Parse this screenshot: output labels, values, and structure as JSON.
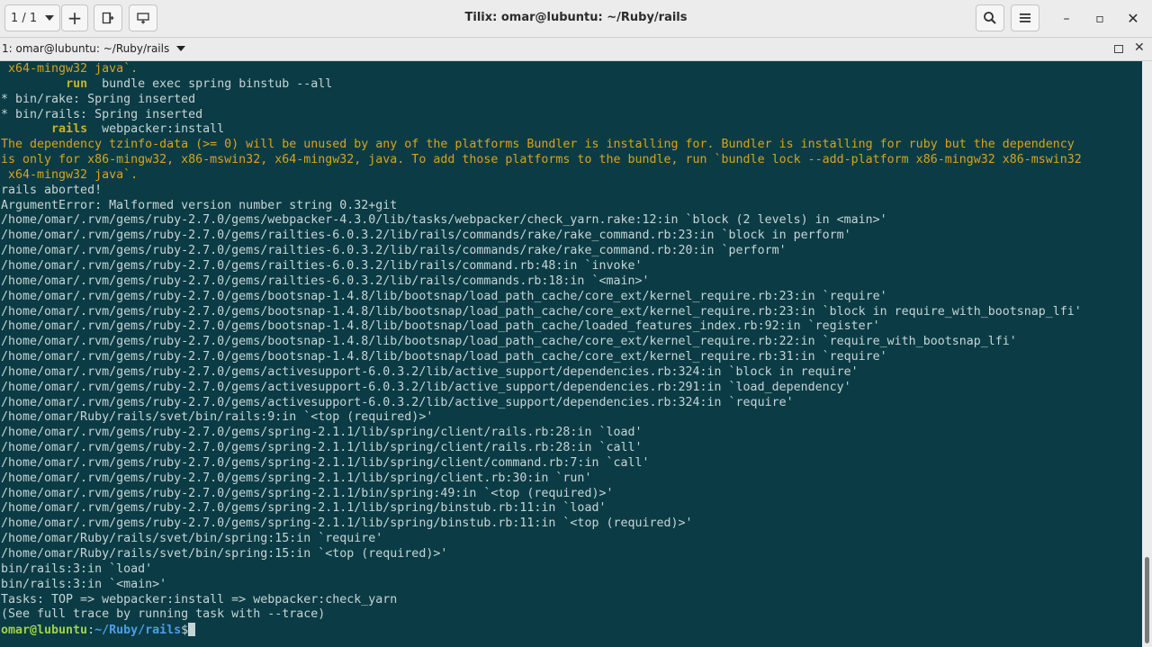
{
  "window": {
    "title": "Tilix: omar@lubuntu: ~/Ruby/rails"
  },
  "header": {
    "session_counter": "1 / 1",
    "add_label": "+",
    "buttons": [
      "add-terminal-right-icon",
      "add-terminal-down-icon"
    ],
    "search_icon": "search-icon",
    "menu_icon": "hamburger-menu-icon",
    "window_controls": {
      "minimize": "–",
      "maximize": "▫",
      "close": "✕"
    }
  },
  "terminal_tab": {
    "title": "1: omar@lubuntu: ~/Ruby/rails",
    "close_label": "✕"
  },
  "terminal": {
    "lines": [
      {
        "type": "warn",
        "text": " x64-mingw32 java`."
      },
      {
        "type": "cmd",
        "indent": "         ",
        "keyword": "run",
        "rest": "  bundle exec spring binstub --all"
      },
      {
        "type": "plain",
        "text": "* bin/rake: Spring inserted"
      },
      {
        "type": "plain",
        "text": "* bin/rails: Spring inserted"
      },
      {
        "type": "cmd",
        "indent": "       ",
        "keyword": "rails",
        "rest": "  webpacker:install"
      },
      {
        "type": "warn",
        "text": "The dependency tzinfo-data (>= 0) will be unused by any of the platforms Bundler is installing for. Bundler is installing for ruby but the dependency"
      },
      {
        "type": "warn",
        "text": "is only for x86-mingw32, x86-mswin32, x64-mingw32, java. To add those platforms to the bundle, run `bundle lock --add-platform x86-mingw32 x86-mswin32"
      },
      {
        "type": "warn",
        "text": " x64-mingw32 java`."
      },
      {
        "type": "plain",
        "text": "rails aborted!"
      },
      {
        "type": "plain",
        "text": "ArgumentError: Malformed version number string 0.32+git"
      },
      {
        "type": "plain",
        "text": "/home/omar/.rvm/gems/ruby-2.7.0/gems/webpacker-4.3.0/lib/tasks/webpacker/check_yarn.rake:12:in `block (2 levels) in <main>'"
      },
      {
        "type": "plain",
        "text": "/home/omar/.rvm/gems/ruby-2.7.0/gems/railties-6.0.3.2/lib/rails/commands/rake/rake_command.rb:23:in `block in perform'"
      },
      {
        "type": "plain",
        "text": "/home/omar/.rvm/gems/ruby-2.7.0/gems/railties-6.0.3.2/lib/rails/commands/rake/rake_command.rb:20:in `perform'"
      },
      {
        "type": "plain",
        "text": "/home/omar/.rvm/gems/ruby-2.7.0/gems/railties-6.0.3.2/lib/rails/command.rb:48:in `invoke'"
      },
      {
        "type": "plain",
        "text": "/home/omar/.rvm/gems/ruby-2.7.0/gems/railties-6.0.3.2/lib/rails/commands.rb:18:in `<main>'"
      },
      {
        "type": "plain",
        "text": "/home/omar/.rvm/gems/ruby-2.7.0/gems/bootsnap-1.4.8/lib/bootsnap/load_path_cache/core_ext/kernel_require.rb:23:in `require'"
      },
      {
        "type": "plain",
        "text": "/home/omar/.rvm/gems/ruby-2.7.0/gems/bootsnap-1.4.8/lib/bootsnap/load_path_cache/core_ext/kernel_require.rb:23:in `block in require_with_bootsnap_lfi'"
      },
      {
        "type": "plain",
        "text": "/home/omar/.rvm/gems/ruby-2.7.0/gems/bootsnap-1.4.8/lib/bootsnap/load_path_cache/loaded_features_index.rb:92:in `register'"
      },
      {
        "type": "plain",
        "text": "/home/omar/.rvm/gems/ruby-2.7.0/gems/bootsnap-1.4.8/lib/bootsnap/load_path_cache/core_ext/kernel_require.rb:22:in `require_with_bootsnap_lfi'"
      },
      {
        "type": "plain",
        "text": "/home/omar/.rvm/gems/ruby-2.7.0/gems/bootsnap-1.4.8/lib/bootsnap/load_path_cache/core_ext/kernel_require.rb:31:in `require'"
      },
      {
        "type": "plain",
        "text": "/home/omar/.rvm/gems/ruby-2.7.0/gems/activesupport-6.0.3.2/lib/active_support/dependencies.rb:324:in `block in require'"
      },
      {
        "type": "plain",
        "text": "/home/omar/.rvm/gems/ruby-2.7.0/gems/activesupport-6.0.3.2/lib/active_support/dependencies.rb:291:in `load_dependency'"
      },
      {
        "type": "plain",
        "text": "/home/omar/.rvm/gems/ruby-2.7.0/gems/activesupport-6.0.3.2/lib/active_support/dependencies.rb:324:in `require'"
      },
      {
        "type": "plain",
        "text": "/home/omar/Ruby/rails/svet/bin/rails:9:in `<top (required)>'"
      },
      {
        "type": "plain",
        "text": "/home/omar/.rvm/gems/ruby-2.7.0/gems/spring-2.1.1/lib/spring/client/rails.rb:28:in `load'"
      },
      {
        "type": "plain",
        "text": "/home/omar/.rvm/gems/ruby-2.7.0/gems/spring-2.1.1/lib/spring/client/rails.rb:28:in `call'"
      },
      {
        "type": "plain",
        "text": "/home/omar/.rvm/gems/ruby-2.7.0/gems/spring-2.1.1/lib/spring/client/command.rb:7:in `call'"
      },
      {
        "type": "plain",
        "text": "/home/omar/.rvm/gems/ruby-2.7.0/gems/spring-2.1.1/lib/spring/client.rb:30:in `run'"
      },
      {
        "type": "plain",
        "text": "/home/omar/.rvm/gems/ruby-2.7.0/gems/spring-2.1.1/bin/spring:49:in `<top (required)>'"
      },
      {
        "type": "plain",
        "text": "/home/omar/.rvm/gems/ruby-2.7.0/gems/spring-2.1.1/lib/spring/binstub.rb:11:in `load'"
      },
      {
        "type": "plain",
        "text": "/home/omar/.rvm/gems/ruby-2.7.0/gems/spring-2.1.1/lib/spring/binstub.rb:11:in `<top (required)>'"
      },
      {
        "type": "plain",
        "text": "/home/omar/Ruby/rails/svet/bin/spring:15:in `require'"
      },
      {
        "type": "plain",
        "text": "/home/omar/Ruby/rails/svet/bin/spring:15:in `<top (required)>'"
      },
      {
        "type": "plain",
        "text": "bin/rails:3:in `load'"
      },
      {
        "type": "plain",
        "text": "bin/rails:3:in `<main>'"
      },
      {
        "type": "plain",
        "text": "Tasks: TOP => webpacker:install => webpacker:check_yarn"
      },
      {
        "type": "plain",
        "text": "(See full trace by running task with --trace)"
      },
      {
        "type": "prompt",
        "user": "omar@lubuntu",
        "sep": ":",
        "path": "~/Ruby/rails",
        "symbol": "$"
      }
    ]
  },
  "colors": {
    "terminal_bg": "#0b3c45",
    "text": "#c6d4d6",
    "warning": "#d8a31c",
    "keyword": "#c4b42a",
    "prompt_user": "#9fd24a",
    "prompt_path": "#4d9ee4"
  }
}
